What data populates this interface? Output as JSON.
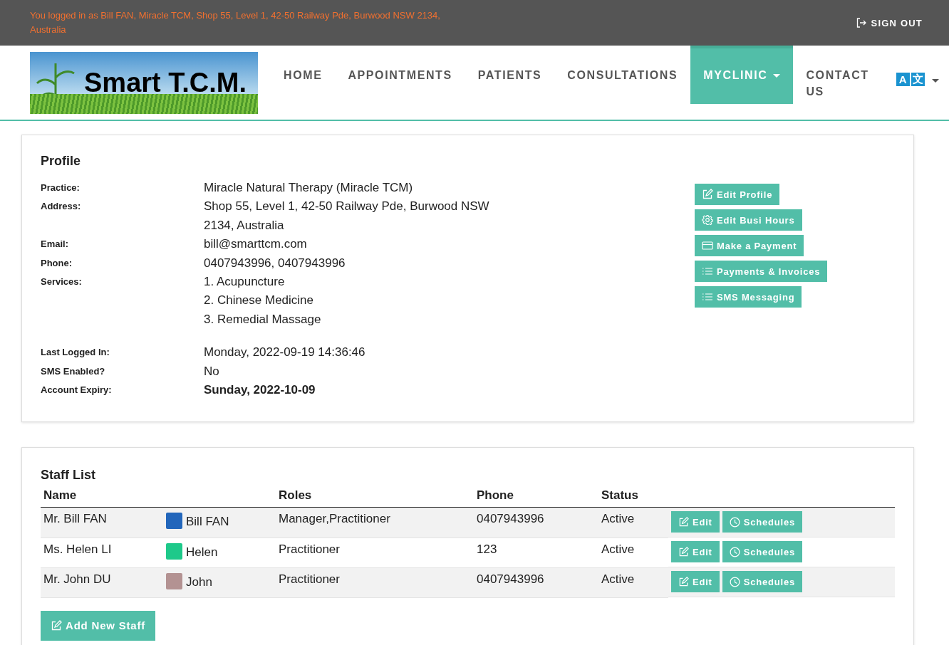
{
  "top_bar": {
    "login_info": "You logged in as Bill FAN, Miracle TCM, Shop 55, Level 1, 42-50 Railway Pde, Burwood NSW 2134, Australia",
    "sign_out": "SIGN OUT"
  },
  "logo": {
    "text": "Smart T.C.M."
  },
  "nav": [
    {
      "label": "HOME",
      "selected": false,
      "dropdown": false
    },
    {
      "label": "APPOINTMENTS",
      "selected": false,
      "dropdown": false
    },
    {
      "label": "PATIENTS",
      "selected": false,
      "dropdown": false
    },
    {
      "label": "CONSULTATIONS",
      "selected": false,
      "dropdown": false
    },
    {
      "label": "MYCLINIC",
      "selected": true,
      "dropdown": true
    },
    {
      "label": "CONTACT US",
      "selected": false,
      "dropdown": false
    }
  ],
  "language_button": {
    "glyphs": [
      "A",
      "文"
    ]
  },
  "profile": {
    "title": "Profile",
    "groups": [
      [
        {
          "label": "Practice:",
          "lines": [
            "Miracle Natural Therapy (Miracle TCM)"
          ],
          "emphasis": false
        },
        {
          "label": "Address:",
          "lines": [
            "Shop 55, Level 1, 42-50 Railway Pde, Burwood NSW 2134, Australia"
          ],
          "emphasis": false
        },
        {
          "label": "Email:",
          "lines": [
            "bill@smarttcm.com"
          ],
          "emphasis": false
        },
        {
          "label": "Phone:",
          "lines": [
            "0407943996, 0407943996"
          ],
          "emphasis": false
        },
        {
          "label": "Services:",
          "lines": [
            "1. Acupuncture",
            "2. Chinese Medicine",
            "3. Remedial Massage"
          ],
          "emphasis": false
        }
      ],
      [
        {
          "label": "Last Logged In:",
          "lines": [
            "Monday, 2022-09-19 14:36:46"
          ],
          "emphasis": false
        },
        {
          "label": "SMS Enabled?",
          "lines": [
            "No"
          ],
          "emphasis": false
        },
        {
          "label": "Account Expiry:",
          "lines": [
            "Sunday, 2022-10-09"
          ],
          "emphasis": true
        }
      ]
    ],
    "actions": [
      {
        "label": "Edit Profile",
        "kind": "edit"
      },
      {
        "label": "Edit Busi Hours",
        "kind": "settings"
      },
      {
        "label": "Make a Payment",
        "kind": "card"
      },
      {
        "label": "Payments & Invoices",
        "kind": "list"
      },
      {
        "label": "SMS Messaging",
        "kind": "list"
      }
    ]
  },
  "staff": {
    "title": "Staff List",
    "columns": [
      "Name",
      "Roles",
      "Phone",
      "Status"
    ],
    "rows": [
      {
        "name": "Mr. Bill FAN",
        "short_name": "Bill FAN",
        "color": "#2266bb",
        "roles": "Manager,Practitioner",
        "phone": "0407943996",
        "status": "Active",
        "edit": "Edit",
        "schedules": "Schedules"
      },
      {
        "name": "Ms. Helen LI",
        "short_name": "Helen",
        "color": "#1ec98a",
        "roles": "Practitioner",
        "phone": "123",
        "status": "Active",
        "edit": "Edit",
        "schedules": "Schedules"
      },
      {
        "name": "Mr. John DU",
        "short_name": "John",
        "color": "#b39292",
        "roles": "Practitioner",
        "phone": "0407943996",
        "status": "Active",
        "edit": "Edit",
        "schedules": "Schedules"
      }
    ],
    "add_button": "Add New Staff"
  }
}
